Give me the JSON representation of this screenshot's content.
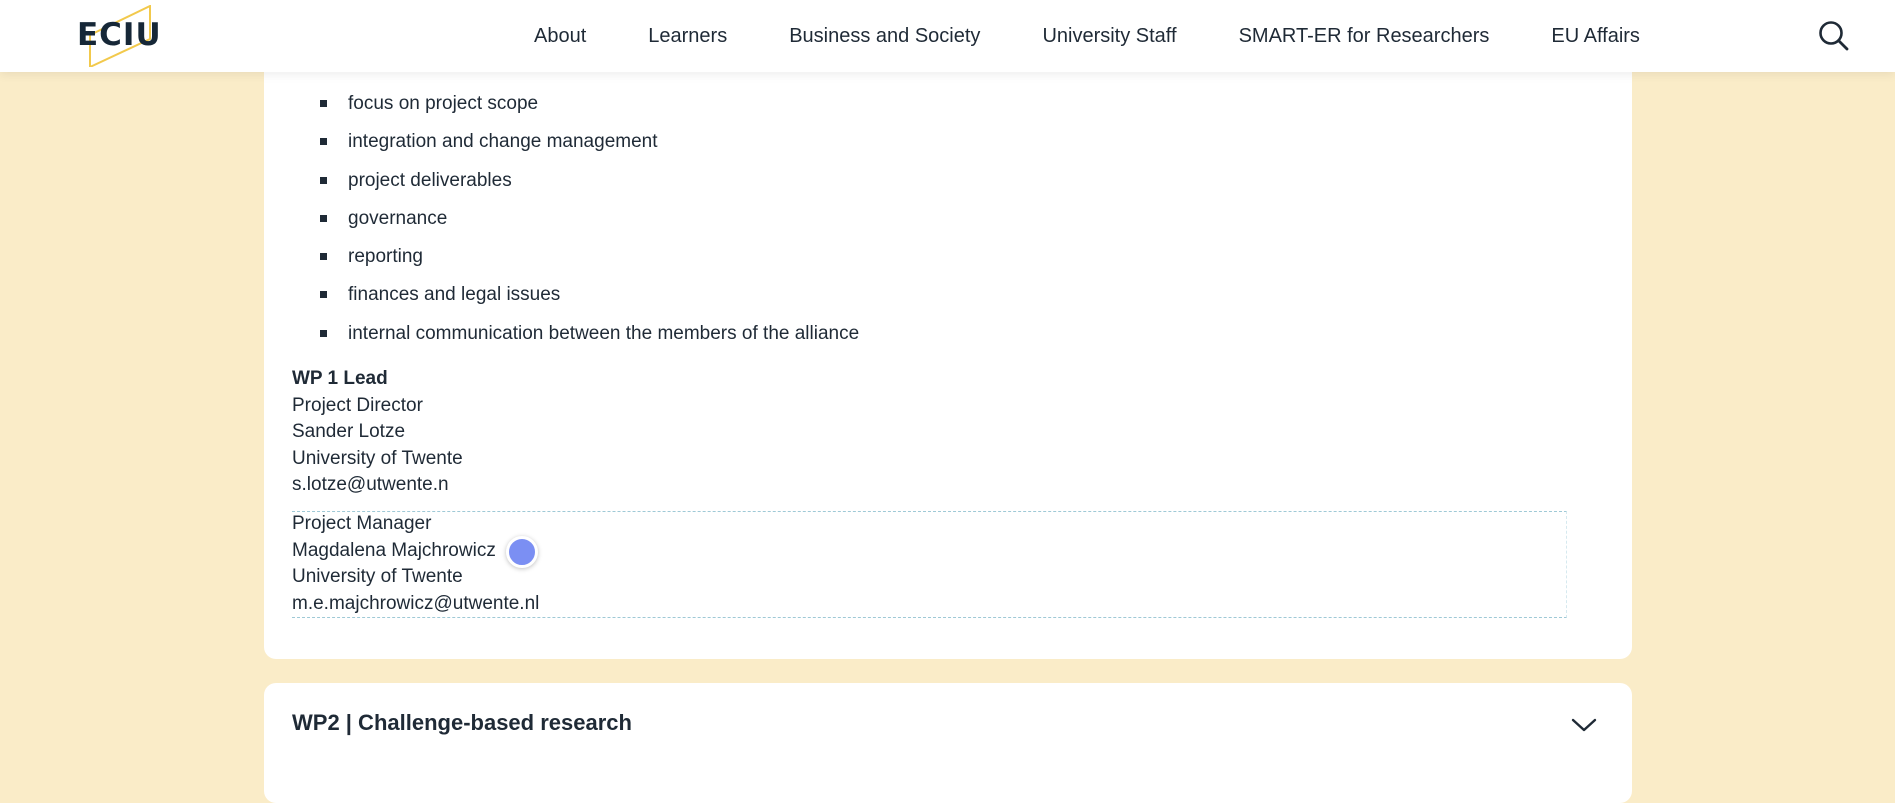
{
  "header": {
    "logo_text": "ECIU",
    "nav": [
      {
        "label": "About"
      },
      {
        "label": "Learners"
      },
      {
        "label": "Business and Society"
      },
      {
        "label": "University Staff"
      },
      {
        "label": "SMART-ER for Researchers"
      },
      {
        "label": "EU Affairs"
      }
    ],
    "search_icon": "search-icon"
  },
  "wp1": {
    "tasks": [
      "focus on project scope",
      "integration and change management",
      "project deliverables",
      "governance",
      "reporting",
      "finances and legal issues",
      "internal communication between the members of the alliance"
    ],
    "lead": {
      "heading": "WP 1 Lead",
      "role": "Project Director",
      "name": "Sander Lotze",
      "org": "University of Twente",
      "email": "s.lotze@utwente.n"
    },
    "manager": {
      "role": "Project Manager",
      "name": "Magdalena Majchrowicz",
      "org": "University of Twente",
      "email": "m.e.majchrowicz@utwente.nl"
    }
  },
  "wp2": {
    "title": "WP2 | Challenge-based research",
    "chevron_icon": "chevron-down-icon"
  },
  "colors": {
    "page_background": "#faecc8",
    "card_background": "#ffffff",
    "text": "#1f2a36",
    "cursor": "#7b8ff3",
    "logo_accent": "#f2c94c"
  }
}
